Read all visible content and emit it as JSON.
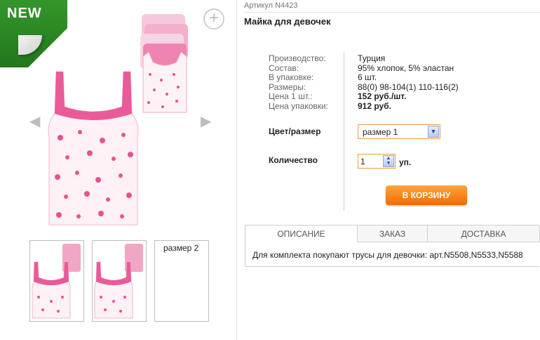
{
  "badge": {
    "label": "NEW"
  },
  "product": {
    "article": "Артикул N4423",
    "title": "Майка для девочек"
  },
  "specs": [
    {
      "key": "Производство:",
      "value": "Турция",
      "bold": false
    },
    {
      "key": "Состав:",
      "value": "95% хлопок, 5% эластан",
      "bold": false
    },
    {
      "key": "В упаковке:",
      "value": "6 шт.",
      "bold": false
    },
    {
      "key": "Размеры:",
      "value": "88(0) 98-104(1) 110-116(2)",
      "bold": false
    },
    {
      "key": "Цена 1 шт.:",
      "value": "152 руб./шт.",
      "bold": true
    },
    {
      "key": "Цена упаковки:",
      "value": "912 руб.",
      "bold": true
    }
  ],
  "color_size": {
    "label": "Цвет/размер",
    "selected": "размер 1"
  },
  "quantity": {
    "label": "Количество",
    "value": "1",
    "unit": "уп."
  },
  "cart_button": {
    "label": "В КОРЗИНУ"
  },
  "thumbnails": {
    "third_label": "размер 2"
  },
  "tabs": [
    {
      "label": "ОПИСАНИЕ"
    },
    {
      "label": "ЗАКАЗ"
    },
    {
      "label": "ДОСТАВКА"
    }
  ],
  "tab_content": "Для комплекта покупают трусы для девочки: арт.N5508,N5533,N5588",
  "icons": {
    "zoom": "plus-icon",
    "prev": "chevron-left-icon",
    "next": "chevron-right-icon",
    "dropdown": "chevron-down-icon",
    "spinner": "spinner-icon"
  },
  "colors": {
    "accent": "#f36a00",
    "badge": "#3fae34",
    "product_pink": "#e8518e"
  }
}
